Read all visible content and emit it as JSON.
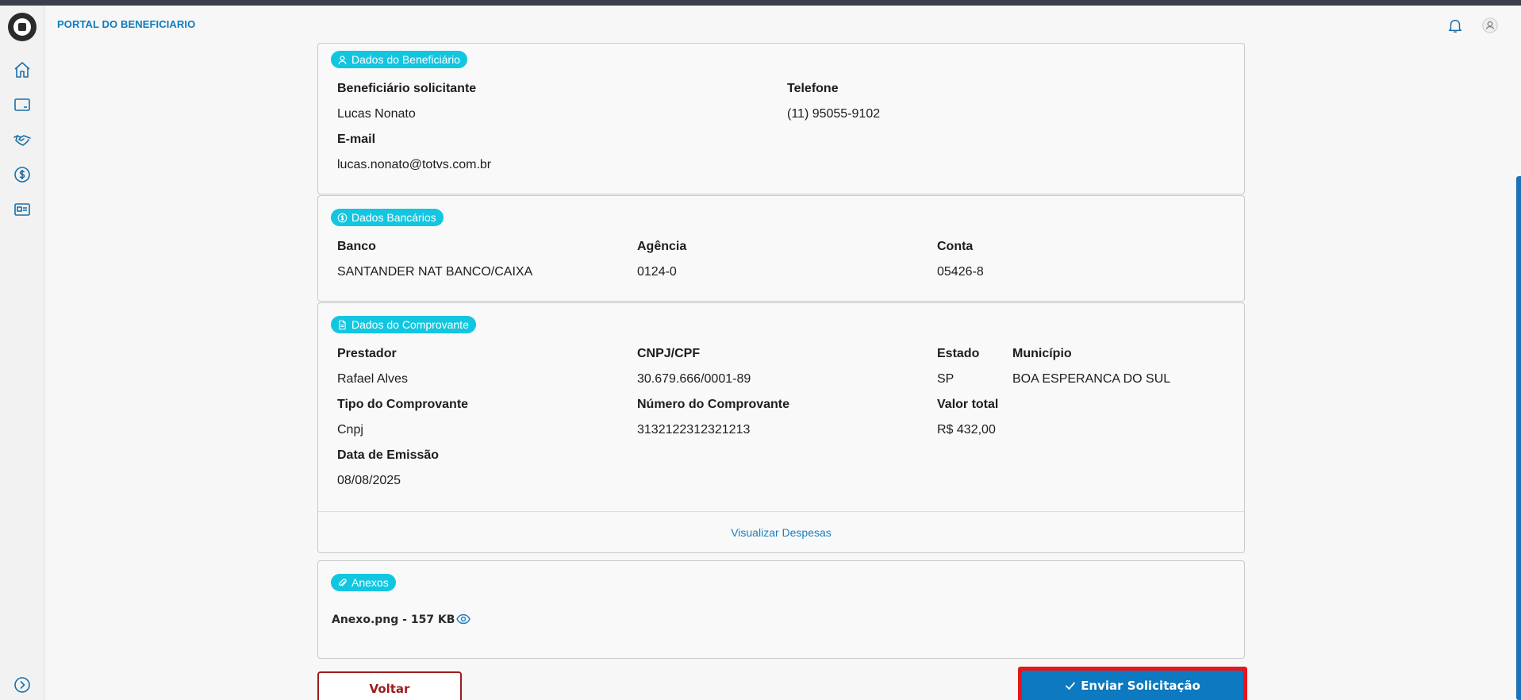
{
  "header": {
    "title": "PORTAL DO BENEFICIARIO"
  },
  "beneficiario": {
    "chip": "Dados do Beneficiário",
    "solicitante_label": "Beneficiário solicitante",
    "solicitante_value": "Lucas Nonato",
    "telefone_label": "Telefone",
    "telefone_value": "(11) 95055-9102",
    "email_label": "E-mail",
    "email_value": "lucas.nonato@totvs.com.br"
  },
  "bancarios": {
    "chip": "Dados Bancários",
    "banco_label": "Banco",
    "banco_value": "SANTANDER NAT BANCO/CAIXA",
    "agencia_label": "Agência",
    "agencia_value": "0124-0",
    "conta_label": "Conta",
    "conta_value": "05426-8"
  },
  "comprovante": {
    "chip": "Dados do Comprovante",
    "prestador_label": "Prestador",
    "prestador_value": "Rafael Alves",
    "cnpj_label": "CNPJ/CPF",
    "cnpj_value": "30.679.666/0001-89",
    "estado_label": "Estado",
    "estado_value": "SP",
    "municipio_label": "Município",
    "municipio_value": "BOA ESPERANCA DO SUL",
    "tipo_label": "Tipo do Comprovante",
    "tipo_value": "Cnpj",
    "numero_label": "Número do Comprovante",
    "numero_value": "3132122312321213",
    "valor_label": "Valor total",
    "valor_value": "R$ 432,00",
    "emissao_label": "Data de Emissão",
    "emissao_value": "08/08/2025",
    "link": "Visualizar Despesas"
  },
  "anexos": {
    "chip": "Anexos",
    "file": "Anexo.png - 157 KB"
  },
  "actions": {
    "back": "Voltar",
    "send": "Enviar Solicitação"
  },
  "colors": {
    "brand": "#0c79c0",
    "chip": "#13c6e0",
    "back_border": "#9c1c1c",
    "highlight": "#e8151b"
  }
}
